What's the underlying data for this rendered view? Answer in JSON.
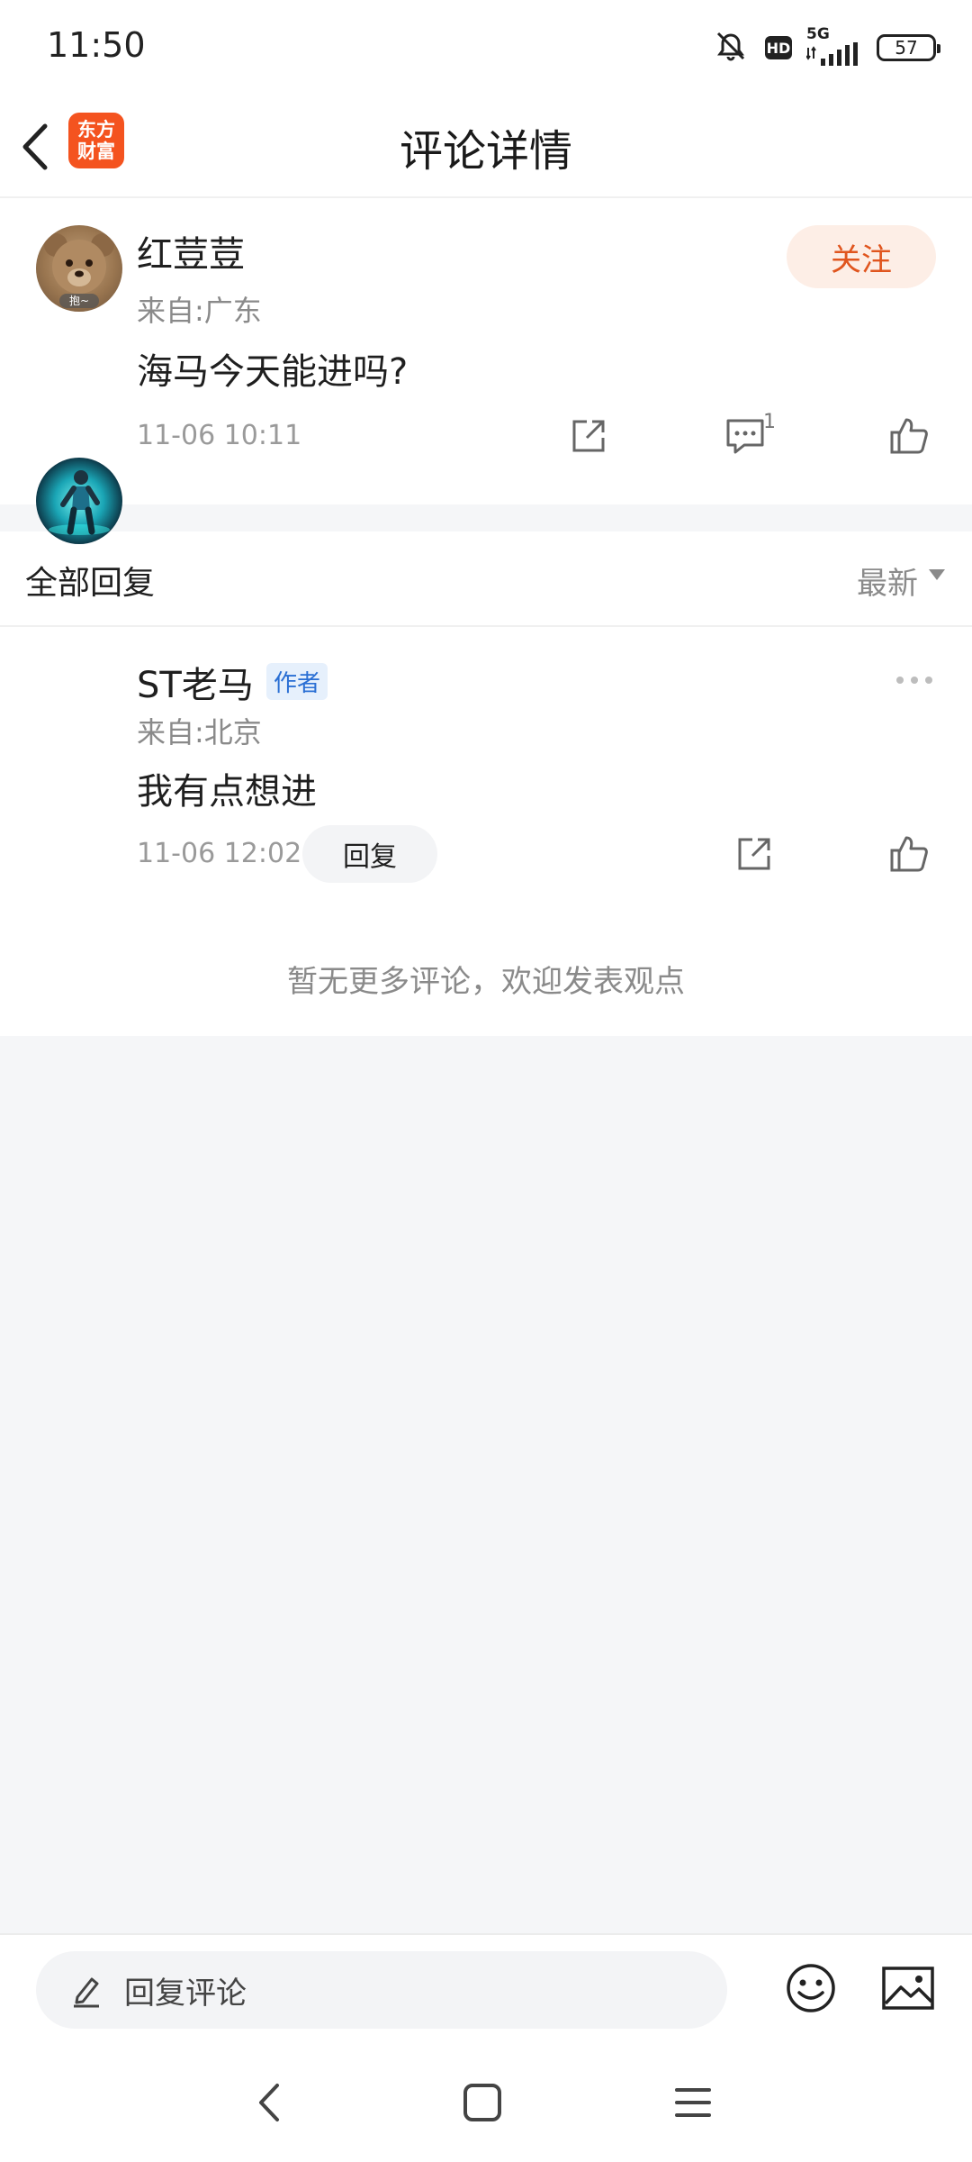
{
  "status_bar": {
    "time": "11:50",
    "hd": "HD",
    "network": "5G",
    "battery": "57"
  },
  "header": {
    "logo_line1": "东方",
    "logo_line2": "财富",
    "title": "评论详情"
  },
  "main_comment": {
    "username": "红荳荳",
    "location": "来自:广东",
    "text": "海马今天能进吗?",
    "timestamp": "11-06 10:11",
    "follow_label": "关注",
    "reply_count": "1",
    "avatar_caption": "抱~"
  },
  "replies": {
    "title": "全部回复",
    "sort_label": "最新",
    "items": [
      {
        "username": "ST老马",
        "badge": "作者",
        "location": "来自:北京",
        "text": "我有点想进",
        "timestamp": "11-06 12:02",
        "reply_button": "回复"
      }
    ],
    "no_more": "暂无更多评论，欢迎发表观点"
  },
  "input_bar": {
    "placeholder": "回复评论"
  },
  "colors": {
    "brand": "#f4531f",
    "follow_text": "#e0551e",
    "follow_bg": "#fdeee6",
    "author_badge": "#2a6fd4",
    "page_bg": "#f5f6f8"
  }
}
